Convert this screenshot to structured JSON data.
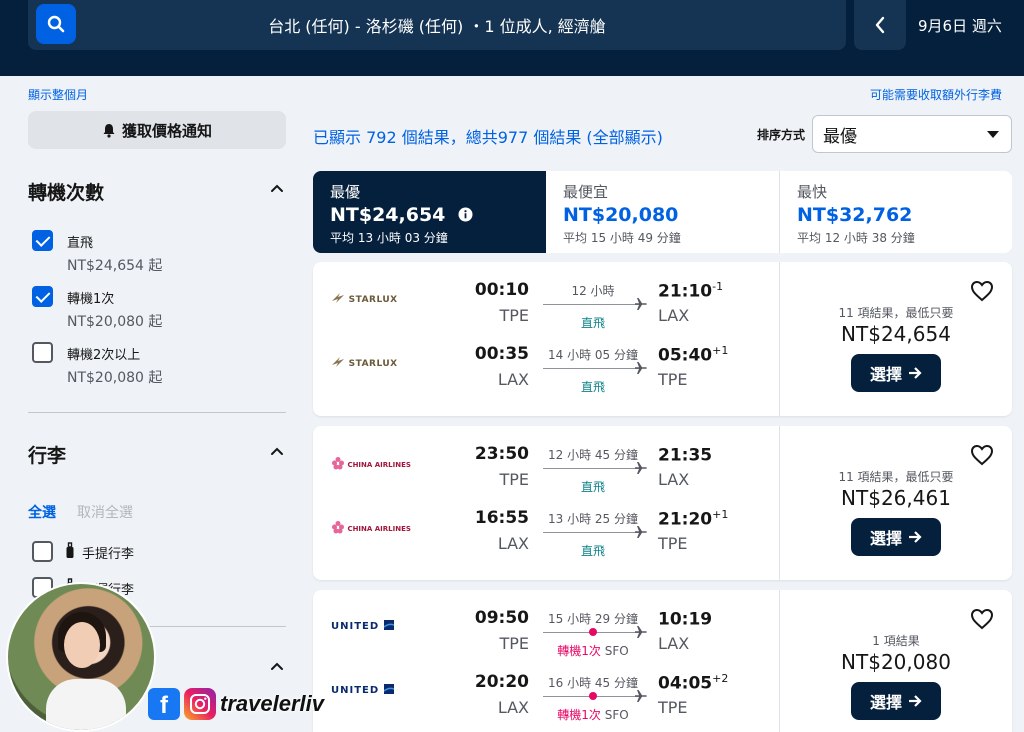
{
  "header": {
    "route": "台北 (任何) - 洛杉磯 (任何) ・1 位成人, 經濟艙",
    "date": "9月6日 週六"
  },
  "links": {
    "show_month": "顯示整個月",
    "baggage_fee": "可能需要收取額外行李費"
  },
  "sidebar": {
    "alert_label": "獲取價格通知",
    "stops_title": "轉機次數",
    "stops": [
      {
        "label": "直飛",
        "price": "NT$24,654 起",
        "checked": true
      },
      {
        "label": "轉機1次",
        "price": "NT$20,080 起",
        "checked": true
      },
      {
        "label": "轉機2次以上",
        "price": "NT$20,080 起",
        "checked": false
      }
    ],
    "baggage_title": "行李",
    "select_all": "全選",
    "deselect_all": "取消全選",
    "baggage": [
      {
        "label": "手提行李",
        "checked": false
      },
      {
        "label": "托運行李",
        "checked": false
      }
    ]
  },
  "main": {
    "results_count": "已顯示 792 個結果，總共977 個結果 (全部顯示)",
    "sort_label": "排序方式",
    "sort_value": "最優"
  },
  "tabs": [
    {
      "label": "最優",
      "price": "NT$24,654",
      "time": "平均 13 小時 03 分鐘",
      "active": true
    },
    {
      "label": "最便宜",
      "price": "NT$20,080",
      "time": "平均 15 小時 49 分鐘",
      "active": false
    },
    {
      "label": "最快",
      "price": "NT$32,762",
      "time": "平均 12 小時 38 分鐘",
      "active": false
    }
  ],
  "cards": [
    {
      "airline": "STARLUX",
      "legs": [
        {
          "dep_time": "00:10",
          "dep_ap": "TPE",
          "duration": "12 小時",
          "stops": "直飛",
          "arr_time": "21:10",
          "arr_offset": "-1",
          "arr_ap": "LAX"
        },
        {
          "dep_time": "00:35",
          "dep_ap": "LAX",
          "duration": "14 小時 05 分鐘",
          "stops": "直飛",
          "arr_time": "05:40",
          "arr_offset": "+1",
          "arr_ap": "TPE"
        }
      ],
      "summary": "11 項結果，最低只要",
      "price": "NT$24,654",
      "select_label": "選擇"
    },
    {
      "airline": "CHINA AIRLINES",
      "legs": [
        {
          "dep_time": "23:50",
          "dep_ap": "TPE",
          "duration": "12 小時 45 分鐘",
          "stops": "直飛",
          "arr_time": "21:35",
          "arr_offset": "",
          "arr_ap": "LAX"
        },
        {
          "dep_time": "16:55",
          "dep_ap": "LAX",
          "duration": "13 小時 25 分鐘",
          "stops": "直飛",
          "arr_time": "21:20",
          "arr_offset": "+1",
          "arr_ap": "TPE"
        }
      ],
      "summary": "11 項結果，最低只要",
      "price": "NT$26,461",
      "select_label": "選擇"
    },
    {
      "airline": "UNITED",
      "legs": [
        {
          "dep_time": "09:50",
          "dep_ap": "TPE",
          "duration": "15 小時 29 分鐘",
          "stops": "轉機1次",
          "via": "SFO",
          "arr_time": "10:19",
          "arr_offset": "",
          "arr_ap": "LAX"
        },
        {
          "dep_time": "20:20",
          "dep_ap": "LAX",
          "duration": "16 小時 45 分鐘",
          "stops": "轉機1次",
          "via": "SFO",
          "arr_time": "04:05",
          "arr_offset": "+2",
          "arr_ap": "TPE"
        }
      ],
      "summary": "1 項結果",
      "price": "NT$20,080",
      "select_label": "選擇"
    }
  ],
  "overlay": {
    "handle": "travelerliv"
  },
  "colors": {
    "navy": "#05203c",
    "blue": "#0062e3",
    "teal": "#0c838a",
    "pink": "#e70866"
  }
}
